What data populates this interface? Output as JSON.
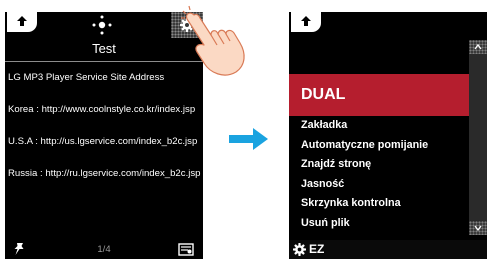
{
  "left_screen": {
    "title": "Test",
    "content": [
      "LG MP3 Player Service Site Address",
      "",
      "Korea : http://www.coolnstyle.co.kr/index.jsp",
      "",
      "U.S.A : http://us.lgservice.com/index_b2c.jsp",
      "",
      "Russia : http://ru.lgservice.com/index_b2c.jsp"
    ],
    "page_indicator": "1/4",
    "icons": {
      "back": "back-arrow-icon",
      "nav": "directional-pad-icon",
      "settings": "gear-icon",
      "pin": "pin-icon",
      "document": "document-icon"
    }
  },
  "right_screen": {
    "selected_item": "DUAL",
    "menu_items": [
      "Zakładka",
      "Automatyczne pomijanie",
      "Znajdź stronę",
      "Jasność",
      "Skrzynka kontrolna",
      "Usuń plik"
    ],
    "footer_label": "EZ",
    "icons": {
      "back": "back-arrow-icon",
      "scroll_up": "chevron-up-icon",
      "scroll_down": "chevron-down-icon",
      "settings": "gear-icon"
    }
  },
  "colors": {
    "screen_background": "#000000",
    "selected_highlight": "#b51e2e",
    "arrow": "#1aa3e0"
  }
}
